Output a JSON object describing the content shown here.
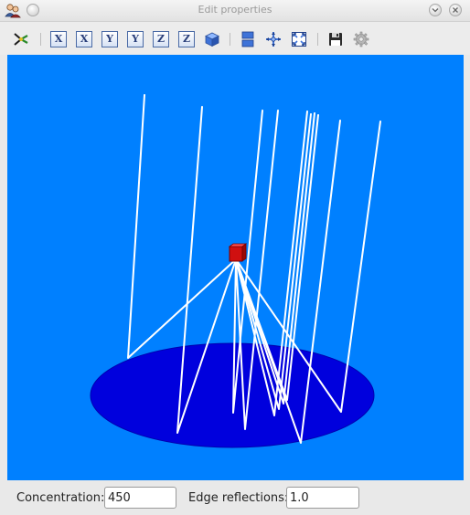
{
  "window": {
    "title": "Edit properties"
  },
  "toolbar": {
    "buttons": [
      {
        "icon": "scatter-tool-icon"
      },
      {
        "icon": "view-x-icon",
        "label": "X"
      },
      {
        "icon": "view-x-reverse-icon",
        "label": "X"
      },
      {
        "icon": "view-y-icon",
        "label": "Y"
      },
      {
        "icon": "view-y-reverse-icon",
        "label": "Y"
      },
      {
        "icon": "view-z-icon",
        "label": "Z"
      },
      {
        "icon": "view-z-reverse-icon",
        "label": "Z"
      },
      {
        "icon": "cube-view-icon"
      },
      {
        "icon": "split-view-icon"
      },
      {
        "icon": "rotate-axes-icon"
      },
      {
        "icon": "fit-view-icon"
      },
      {
        "icon": "save-icon"
      },
      {
        "icon": "settings-gear-icon"
      }
    ]
  },
  "scene": {
    "background": "#0080ff",
    "floor_color": "#0000dd",
    "ray_color": "#ffffff",
    "source_color": "#d01010"
  },
  "status": {
    "concentration_label": "Concentration:",
    "concentration_value": "450",
    "edge_reflections_label": "Edge reflections:",
    "edge_reflections_value": "1.0"
  }
}
